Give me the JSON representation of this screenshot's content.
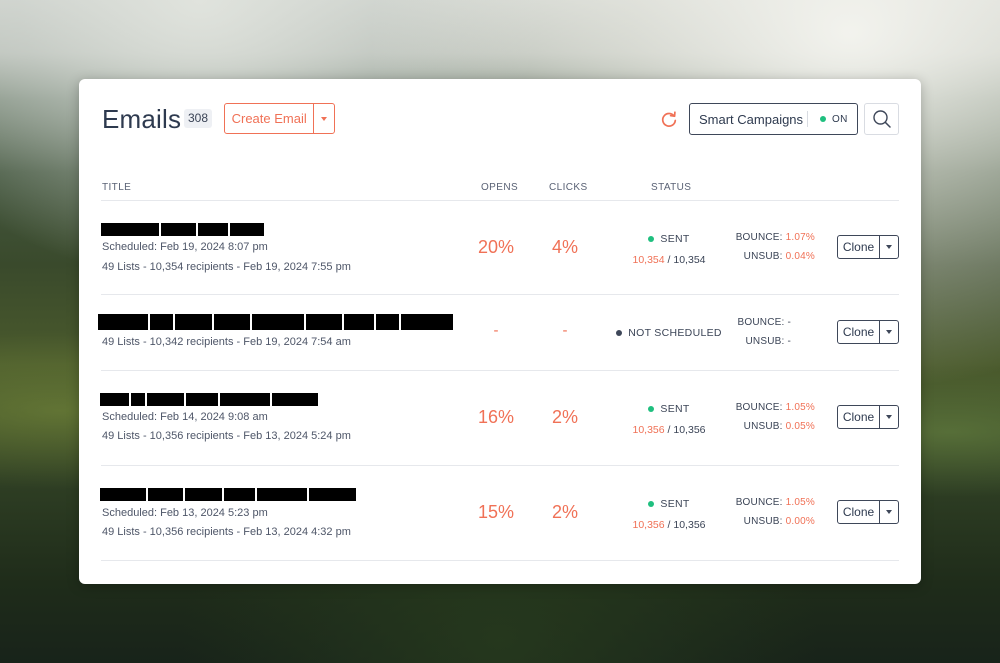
{
  "header": {
    "title": "Emails",
    "count": "308",
    "create_label": "Create Email",
    "smart_label": "Smart Campaigns",
    "smart_state": "ON"
  },
  "columns": {
    "title": "TITLE",
    "opens": "OPENS",
    "clicks": "CLICKS",
    "status": "STATUS"
  },
  "colors": {
    "accent": "#f07156",
    "sent": "#1fbf7f",
    "not_scheduled": "#3e4759"
  },
  "rows": [
    {
      "scheduled": "Scheduled: Feb 19, 2024 8:07 pm",
      "lists": "49 Lists - 10,354 recipients - Feb 19, 2024 7:55 pm",
      "opens": "20%",
      "clicks": "4%",
      "status": "SENT",
      "sent_count": "10,354",
      "recipient_total": "/ 10,354",
      "bounce_label": "BOUNCE:",
      "bounce_value": "1.07%",
      "unsub_label": "UNSUB:",
      "unsub_value": "0.04%",
      "clone_label": "Clone"
    },
    {
      "lists": "49 Lists - 10,342 recipients - Feb 19, 2024 7:54 am",
      "opens": "-",
      "clicks": "-",
      "status": "NOT SCHEDULED",
      "bounce_label": "BOUNCE:",
      "bounce_value": "-",
      "unsub_label": "UNSUB:",
      "unsub_value": "-",
      "clone_label": "Clone"
    },
    {
      "scheduled": "Scheduled: Feb 14, 2024 9:08 am",
      "lists": "49 Lists - 10,356 recipients - Feb 13, 2024 5:24 pm",
      "opens": "16%",
      "clicks": "2%",
      "status": "SENT",
      "sent_count": "10,356",
      "recipient_total": "/ 10,356",
      "bounce_label": "BOUNCE:",
      "bounce_value": "1.05%",
      "unsub_label": "UNSUB:",
      "unsub_value": "0.05%",
      "clone_label": "Clone"
    },
    {
      "scheduled": "Scheduled: Feb 13, 2024 5:23 pm",
      "lists": "49 Lists - 10,356 recipients - Feb 13, 2024 4:32 pm",
      "opens": "15%",
      "clicks": "2%",
      "status": "SENT",
      "sent_count": "10,356",
      "recipient_total": "/ 10,356",
      "bounce_label": "BOUNCE:",
      "bounce_value": "1.05%",
      "unsub_label": "UNSUB:",
      "unsub_value": "0.00%",
      "clone_label": "Clone"
    }
  ]
}
